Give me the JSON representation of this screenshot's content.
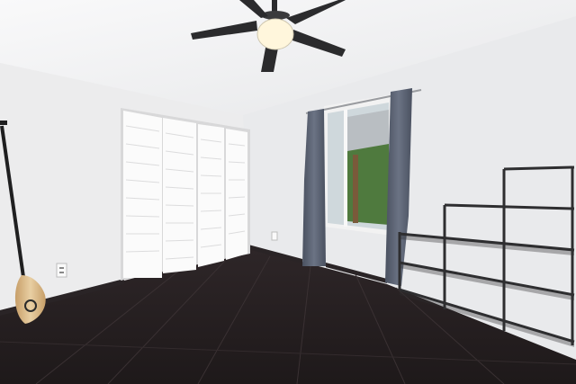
{
  "scene": {
    "kind": "photo-vacant-bedroom",
    "objects": [
      "ceiling-fan-icon",
      "louvered-closet-doors",
      "window",
      "curtain-left",
      "curtain-right",
      "open-metal-shelf",
      "paddle-board-oar",
      "wall-outlet",
      "dark-hardwood-floor"
    ]
  },
  "colors": {
    "wall": "#ededee",
    "ceiling": "#f4f4f5",
    "floor": "#272022",
    "baseboard": "#2a2426",
    "closet": "#fbfbfb",
    "curtain": "#5b6373",
    "fan_blade": "#2b2b2d",
    "shelf": "#2e2e30",
    "oar_blade": "#d9b98a"
  }
}
